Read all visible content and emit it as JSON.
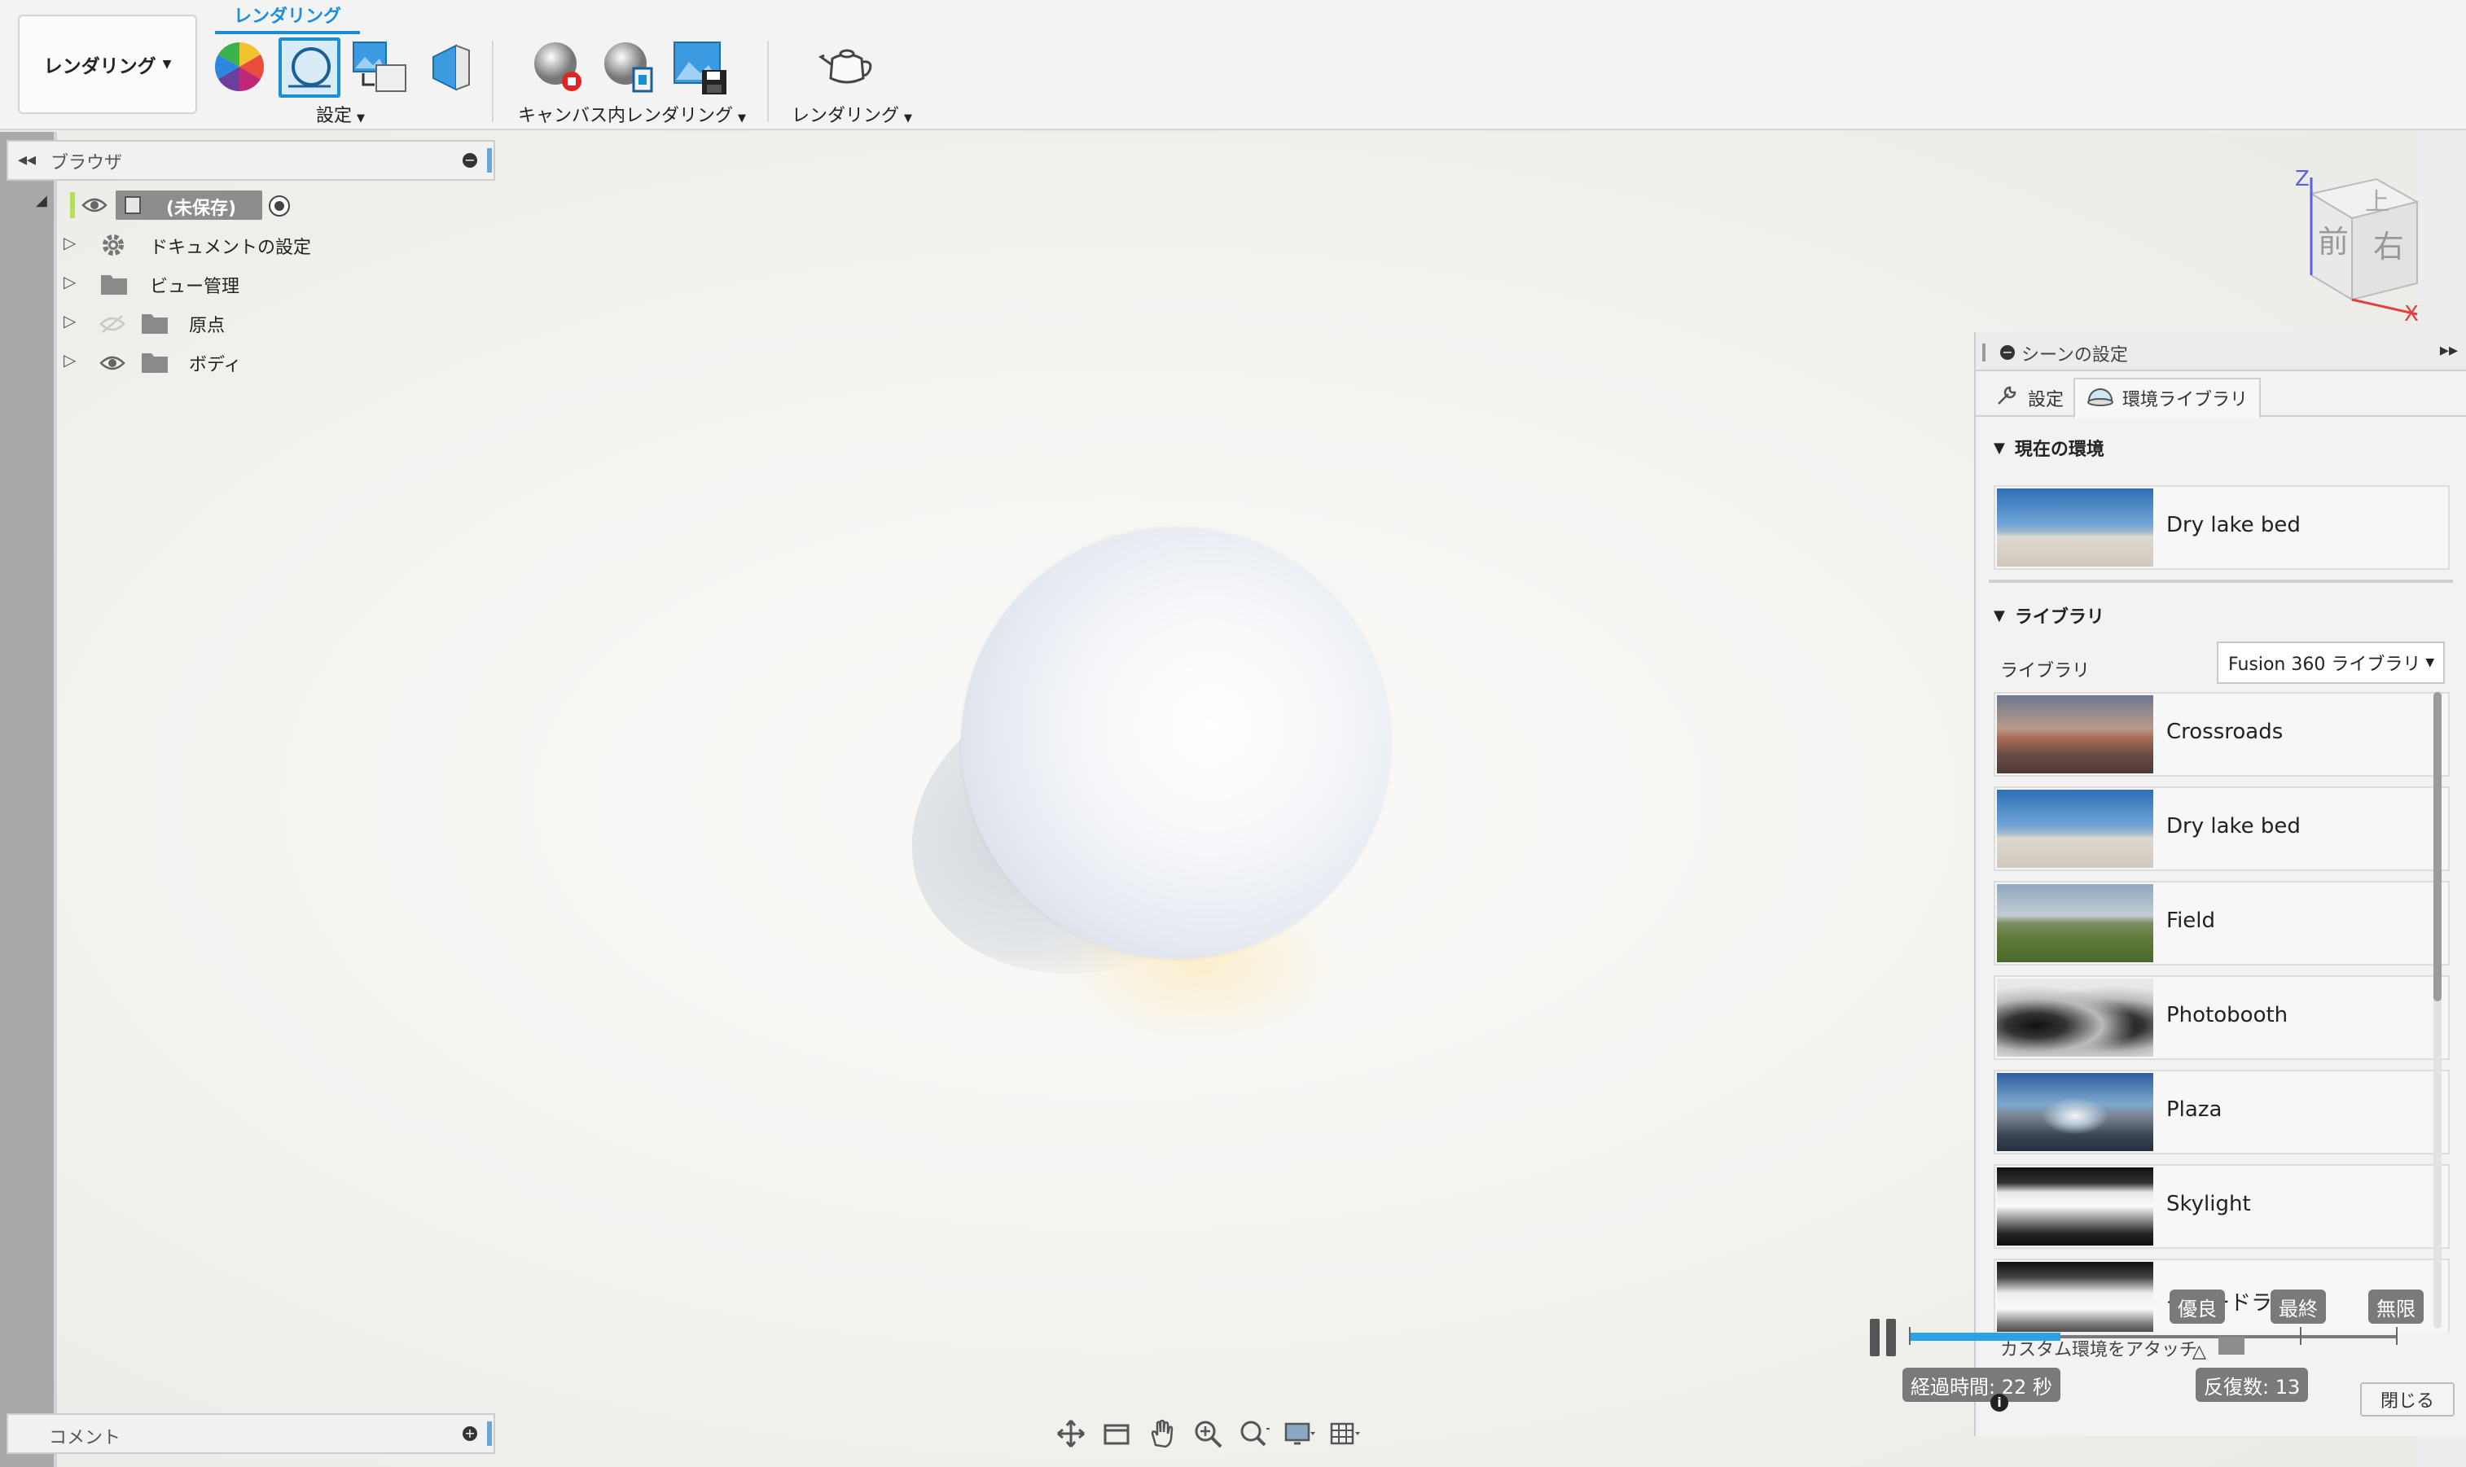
{
  "toolbar": {
    "workspace_label": "レンダリング",
    "tab_label": "レンダリング",
    "setup_label": "設定",
    "incanvas_label": "キャンバス内レンダリング",
    "render_label": "レンダリング"
  },
  "browser": {
    "title": "ブラウザ",
    "items": [
      {
        "label": "(未保存)"
      },
      {
        "label": "ドキュメントの設定"
      },
      {
        "label": "ビュー管理"
      },
      {
        "label": "原点"
      },
      {
        "label": "ボディ"
      }
    ]
  },
  "viewcube": {
    "top": "上",
    "front": "前",
    "right": "右",
    "axis_z": "Z",
    "axis_x": "X"
  },
  "scene_settings": {
    "title": "シーンの設定",
    "tabs": [
      {
        "label": "設定"
      },
      {
        "label": "環境ライブラリ"
      }
    ],
    "current_env_heading": "現在の環境",
    "current_env_name": "Dry lake bed",
    "library_heading": "ライブラリ",
    "library_label": "ライブラリ",
    "library_select": "Fusion 360 ライブラリ",
    "environments": [
      {
        "name": "Crossroads"
      },
      {
        "name": "Dry lake bed"
      },
      {
        "name": "Field"
      },
      {
        "name": "Photobooth"
      },
      {
        "name": "Plaza"
      },
      {
        "name": "Skylight"
      },
      {
        "name": "グレードラ"
      }
    ],
    "attach_label": "カスタム環境をアタッチ",
    "close_label": "閉じる"
  },
  "render_progress": {
    "progress_fraction": 0.31,
    "marker_good": "優良",
    "marker_final": "最終",
    "marker_infinite": "無限",
    "elapsed": "経過時間: 22 秒",
    "iterations": "反復数: 13"
  },
  "comments": {
    "title": "コメント"
  }
}
